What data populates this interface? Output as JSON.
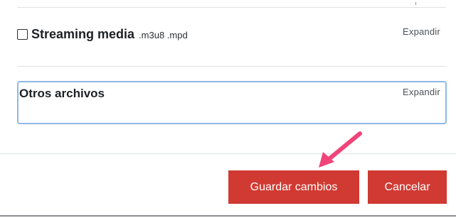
{
  "streaming": {
    "title": "Streaming media",
    "extensions": ".m3u8 .mpd",
    "expand_label": "Expandir",
    "checked": false
  },
  "other_files": {
    "title": "Otros archivos",
    "expand_label": "Expandir"
  },
  "actions": {
    "save_label": "Guardar cambios",
    "cancel_label": "Cancelar"
  },
  "colors": {
    "primary_button": "#d03a32",
    "focus_border": "#8fb8e6",
    "annotation_arrow": "#f0457a"
  },
  "annotation": {
    "icon": "arrow-pointer-icon"
  }
}
